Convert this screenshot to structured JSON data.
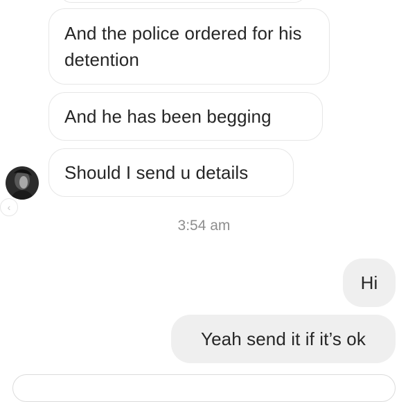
{
  "thread": {
    "incoming": [
      {
        "text": "And the police ordered for his detention"
      },
      {
        "text": "And he has been begging"
      },
      {
        "text": "Should I send u details"
      }
    ],
    "timestamp": "3:54 am",
    "outgoing": [
      {
        "text": "Hi"
      },
      {
        "text": "Yeah send it if it’s ok"
      }
    ]
  },
  "icons": {
    "avatar": "avatar",
    "back": "chevron-left-icon"
  },
  "colors": {
    "outgoing_bubble": "#efefef",
    "incoming_border": "#e6e6e6",
    "timestamp_text": "#8e8e8e",
    "message_text": "#262626"
  }
}
